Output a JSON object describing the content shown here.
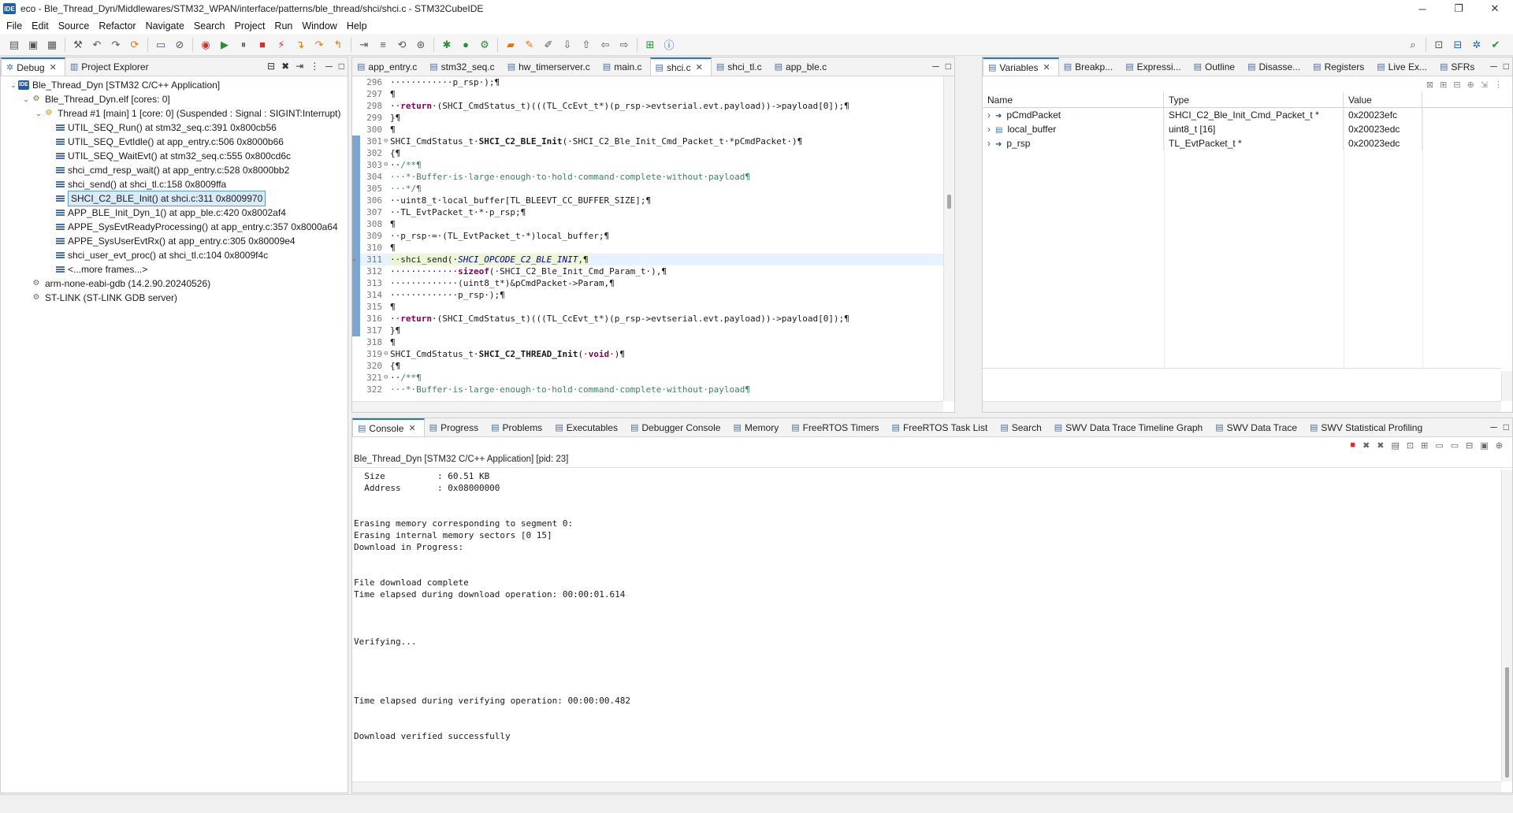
{
  "window": {
    "title": "eco - Ble_Thread_Dyn/Middlewares/STM32_WPAN/interface/patterns/ble_thread/shci/shci.c - STM32CubeIDE",
    "app_icon": "IDE"
  },
  "menu": [
    "File",
    "Edit",
    "Source",
    "Refactor",
    "Navigate",
    "Search",
    "Project",
    "Run",
    "Window",
    "Help"
  ],
  "debug_panel": {
    "tabs": [
      {
        "label": "Debug",
        "active": true
      },
      {
        "label": "Project Explorer",
        "active": false
      }
    ],
    "tree": [
      {
        "indent": 0,
        "twisty": "v",
        "icon": "ide",
        "label": "Ble_Thread_Dyn [STM32 C/C++ Application]"
      },
      {
        "indent": 1,
        "twisty": "v",
        "icon": "gear",
        "label": "Ble_Thread_Dyn.elf [cores: 0]"
      },
      {
        "indent": 2,
        "twisty": "v",
        "icon": "thread",
        "label": "Thread #1 [main] 1 [core: 0] (Suspended : Signal : SIGINT:Interrupt)"
      },
      {
        "indent": 3,
        "twisty": "",
        "icon": "frame",
        "label": "UTIL_SEQ_Run() at stm32_seq.c:391 0x800cb56"
      },
      {
        "indent": 3,
        "twisty": "",
        "icon": "frame",
        "label": "UTIL_SEQ_EvtIdle() at app_entry.c:506 0x8000b66"
      },
      {
        "indent": 3,
        "twisty": "",
        "icon": "frame",
        "label": "UTIL_SEQ_WaitEvt() at stm32_seq.c:555 0x800cd6c"
      },
      {
        "indent": 3,
        "twisty": "",
        "icon": "frame",
        "label": "shci_cmd_resp_wait() at app_entry.c:528 0x8000bb2"
      },
      {
        "indent": 3,
        "twisty": "",
        "icon": "frame",
        "label": "shci_send() at shci_tl.c:158 0x8009ffa"
      },
      {
        "indent": 3,
        "twisty": "",
        "icon": "frame",
        "label": "SHCI_C2_BLE_Init() at shci.c:311 0x8009970",
        "selected": true
      },
      {
        "indent": 3,
        "twisty": "",
        "icon": "frame",
        "label": "APP_BLE_Init_Dyn_1() at app_ble.c:420 0x8002af4"
      },
      {
        "indent": 3,
        "twisty": "",
        "icon": "frame",
        "label": "APPE_SysEvtReadyProcessing() at app_entry.c:357 0x8000a64"
      },
      {
        "indent": 3,
        "twisty": "",
        "icon": "frame",
        "label": "APPE_SysUserEvtRx() at app_entry.c:305 0x80009e4"
      },
      {
        "indent": 3,
        "twisty": "",
        "icon": "frame",
        "label": "shci_user_evt_proc() at shci_tl.c:104 0x8009f4c"
      },
      {
        "indent": 3,
        "twisty": "",
        "icon": "frame",
        "label": "<...more frames...>"
      },
      {
        "indent": 1,
        "twisty": "",
        "icon": "gdb",
        "label": "arm-none-eabi-gdb (14.2.90.20240526)"
      },
      {
        "indent": 1,
        "twisty": "",
        "icon": "gdb",
        "label": "ST-LINK (ST-LINK GDB server)"
      }
    ]
  },
  "editor": {
    "tabs": [
      {
        "label": "app_entry.c",
        "active": false
      },
      {
        "label": "stm32_seq.c",
        "active": false
      },
      {
        "label": "hw_timerserver.c",
        "active": false
      },
      {
        "label": "main.c",
        "active": false
      },
      {
        "label": "shci.c",
        "active": true
      },
      {
        "label": "shci_tl.c",
        "active": false
      },
      {
        "label": "app_ble.c",
        "active": false
      }
    ],
    "lines": [
      {
        "n": "296",
        "fold": "",
        "mark": false,
        "cur": false,
        "html": "············p_rsp·);¶"
      },
      {
        "n": "297",
        "fold": "",
        "mark": false,
        "cur": false,
        "html": "¶"
      },
      {
        "n": "298",
        "fold": "",
        "mark": false,
        "cur": false,
        "html": "··<span class=\"kw\">return</span>·(SHCI_CmdStatus_t)(((TL_CcEvt_t*)(p_rsp->evtserial.evt.payload))->payload[0]);¶"
      },
      {
        "n": "299",
        "fold": "",
        "mark": false,
        "cur": false,
        "html": "}¶"
      },
      {
        "n": "300",
        "fold": "",
        "mark": false,
        "cur": false,
        "html": "¶"
      },
      {
        "n": "301",
        "fold": "⊖",
        "mark": true,
        "cur": false,
        "html": "SHCI_CmdStatus_t·<span class=\"fn\">SHCI_C2_BLE_Init</span>(·SHCI_C2_Ble_Init_Cmd_Packet_t·*pCmdPacket·)¶"
      },
      {
        "n": "302",
        "fold": "",
        "mark": true,
        "cur": false,
        "html": "{¶"
      },
      {
        "n": "303",
        "fold": "⊖",
        "mark": true,
        "cur": false,
        "html": "··<span class=\"cm\">/**¶</span>"
      },
      {
        "n": "304",
        "fold": "",
        "mark": true,
        "cur": false,
        "html": "<span class=\"cm\">···*·Buffer·is·large·enough·to·hold·command·complete·without·payload¶</span>"
      },
      {
        "n": "305",
        "fold": "",
        "mark": true,
        "cur": false,
        "html": "<span class=\"cm\">···*/¶</span>"
      },
      {
        "n": "306",
        "fold": "",
        "mark": true,
        "cur": false,
        "html": "··uint8_t·local_buffer[TL_BLEEVT_CC_BUFFER_SIZE];¶"
      },
      {
        "n": "307",
        "fold": "",
        "mark": true,
        "cur": false,
        "html": "··TL_EvtPacket_t·*·p_rsp;¶"
      },
      {
        "n": "308",
        "fold": "",
        "mark": true,
        "cur": false,
        "html": "¶"
      },
      {
        "n": "309",
        "fold": "",
        "mark": true,
        "cur": false,
        "html": "··p_rsp·=·(TL_EvtPacket_t·*)local_buffer;¶"
      },
      {
        "n": "310",
        "fold": "",
        "mark": true,
        "cur": false,
        "html": "¶"
      },
      {
        "n": "311",
        "fold": "",
        "mark": true,
        "cur": true,
        "html": "··shci_send(·<span class=\"mac\">SHCI_OPCODE_C2_BLE_INIT</span>,¶"
      },
      {
        "n": "312",
        "fold": "",
        "mark": true,
        "cur": false,
        "html": "·············<span class=\"kw\">sizeof</span>(·SHCI_C2_Ble_Init_Cmd_Param_t·),¶"
      },
      {
        "n": "313",
        "fold": "",
        "mark": true,
        "cur": false,
        "html": "·············(uint8_t*)&amp;pCmdPacket->Param,¶"
      },
      {
        "n": "314",
        "fold": "",
        "mark": true,
        "cur": false,
        "html": "·············p_rsp·);¶"
      },
      {
        "n": "315",
        "fold": "",
        "mark": true,
        "cur": false,
        "html": "¶"
      },
      {
        "n": "316",
        "fold": "",
        "mark": true,
        "cur": false,
        "html": "··<span class=\"kw\">return</span>·(SHCI_CmdStatus_t)(((TL_CcEvt_t*)(p_rsp->evtserial.evt.payload))->payload[0]);¶"
      },
      {
        "n": "317",
        "fold": "",
        "mark": true,
        "cur": false,
        "html": "}¶"
      },
      {
        "n": "318",
        "fold": "",
        "mark": false,
        "cur": false,
        "html": "¶"
      },
      {
        "n": "319",
        "fold": "⊖",
        "mark": false,
        "cur": false,
        "html": "SHCI_CmdStatus_t·<span class=\"fn\">SHCI_C2_THREAD_Init</span>(·<span class=\"kw\">void</span>·)¶"
      },
      {
        "n": "320",
        "fold": "",
        "mark": false,
        "cur": false,
        "html": "{¶"
      },
      {
        "n": "321",
        "fold": "⊖",
        "mark": false,
        "cur": false,
        "html": "··<span class=\"cm\">/**¶</span>"
      },
      {
        "n": "322",
        "fold": "",
        "mark": false,
        "cur": false,
        "html": "<span class=\"cm\">···*·Buffer·is·large·enough·to·hold·command·complete·without·payload¶</span>"
      }
    ]
  },
  "variables": {
    "tabs": [
      {
        "label": "Variables",
        "active": true
      },
      {
        "label": "Breakp...",
        "active": false
      },
      {
        "label": "Expressi...",
        "active": false
      },
      {
        "label": "Outline",
        "active": false
      },
      {
        "label": "Disasse...",
        "active": false
      },
      {
        "label": "Registers",
        "active": false
      },
      {
        "label": "Live Ex...",
        "active": false
      },
      {
        "label": "SFRs",
        "active": false
      }
    ],
    "columns": [
      "Name",
      "Type",
      "Value"
    ],
    "rows": [
      {
        "name": "pCmdPacket",
        "type": "SHCI_C2_Ble_Init_Cmd_Packet_t *",
        "value": "0x20023efc"
      },
      {
        "name": "local_buffer",
        "type": "uint8_t [16]",
        "value": "0x20023edc"
      },
      {
        "name": "p_rsp",
        "type": "TL_EvtPacket_t *",
        "value": "0x20023edc"
      }
    ]
  },
  "console": {
    "tabs": [
      {
        "label": "Console",
        "active": true
      },
      {
        "label": "Progress",
        "active": false
      },
      {
        "label": "Problems",
        "active": false
      },
      {
        "label": "Executables",
        "active": false
      },
      {
        "label": "Debugger Console",
        "active": false
      },
      {
        "label": "Memory",
        "active": false
      },
      {
        "label": "FreeRTOS Timers",
        "active": false
      },
      {
        "label": "FreeRTOS Task List",
        "active": false
      },
      {
        "label": "Search",
        "active": false
      },
      {
        "label": "SWV Data Trace Timeline Graph",
        "active": false
      },
      {
        "label": "SWV Data Trace",
        "active": false
      },
      {
        "label": "SWV Statistical Profiling",
        "active": false
      }
    ],
    "header": "Ble_Thread_Dyn [STM32 C/C++ Application]  [pid: 23]",
    "lines": [
      "  Size          : 60.51 KB",
      "  Address       : 0x08000000",
      "",
      "",
      "Erasing memory corresponding to segment 0:",
      "Erasing internal memory sectors [0 15]",
      "Download in Progress:",
      "",
      "",
      "File download complete",
      "Time elapsed during download operation: 00:00:01.614",
      "",
      "",
      "",
      "Verifying...",
      "",
      "",
      "",
      "",
      "Time elapsed during verifying operation: 00:00:00.482",
      "",
      "",
      "Download verified successfully"
    ]
  }
}
